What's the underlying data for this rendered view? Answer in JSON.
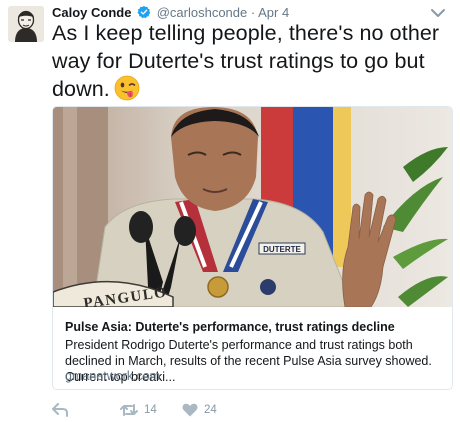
{
  "tweet": {
    "author_name": "Caloy Conde",
    "handle": "@carloshconde",
    "separator": "·",
    "date": "Apr 4",
    "text": "As I keep telling people, there's no other way for Duterte's trust ratings to go but down."
  },
  "card": {
    "photo_seal_text": "PANGULO",
    "badge_text": "DUTERTE",
    "title": "Pulse Asia: Duterte's performance, trust ratings decline",
    "description": "President Rodrigo Duterte's performance and trust ratings both declined in March, results of the recent Pulse Asia survey showed. Current top breaki...",
    "domain": "gmanetwork.com"
  },
  "actions": {
    "retweet_count": "14",
    "like_count": "24"
  },
  "icons": {
    "verified": "verified-badge-icon",
    "caret": "chevron-down-icon",
    "emoji": "winking-face-with-tongue-icon",
    "reply": "reply-icon",
    "retweet": "retweet-icon",
    "like": "heart-icon"
  },
  "colors": {
    "verified_blue": "#1da1f2",
    "muted_text": "#657786",
    "action_gray": "#aab8c2"
  }
}
